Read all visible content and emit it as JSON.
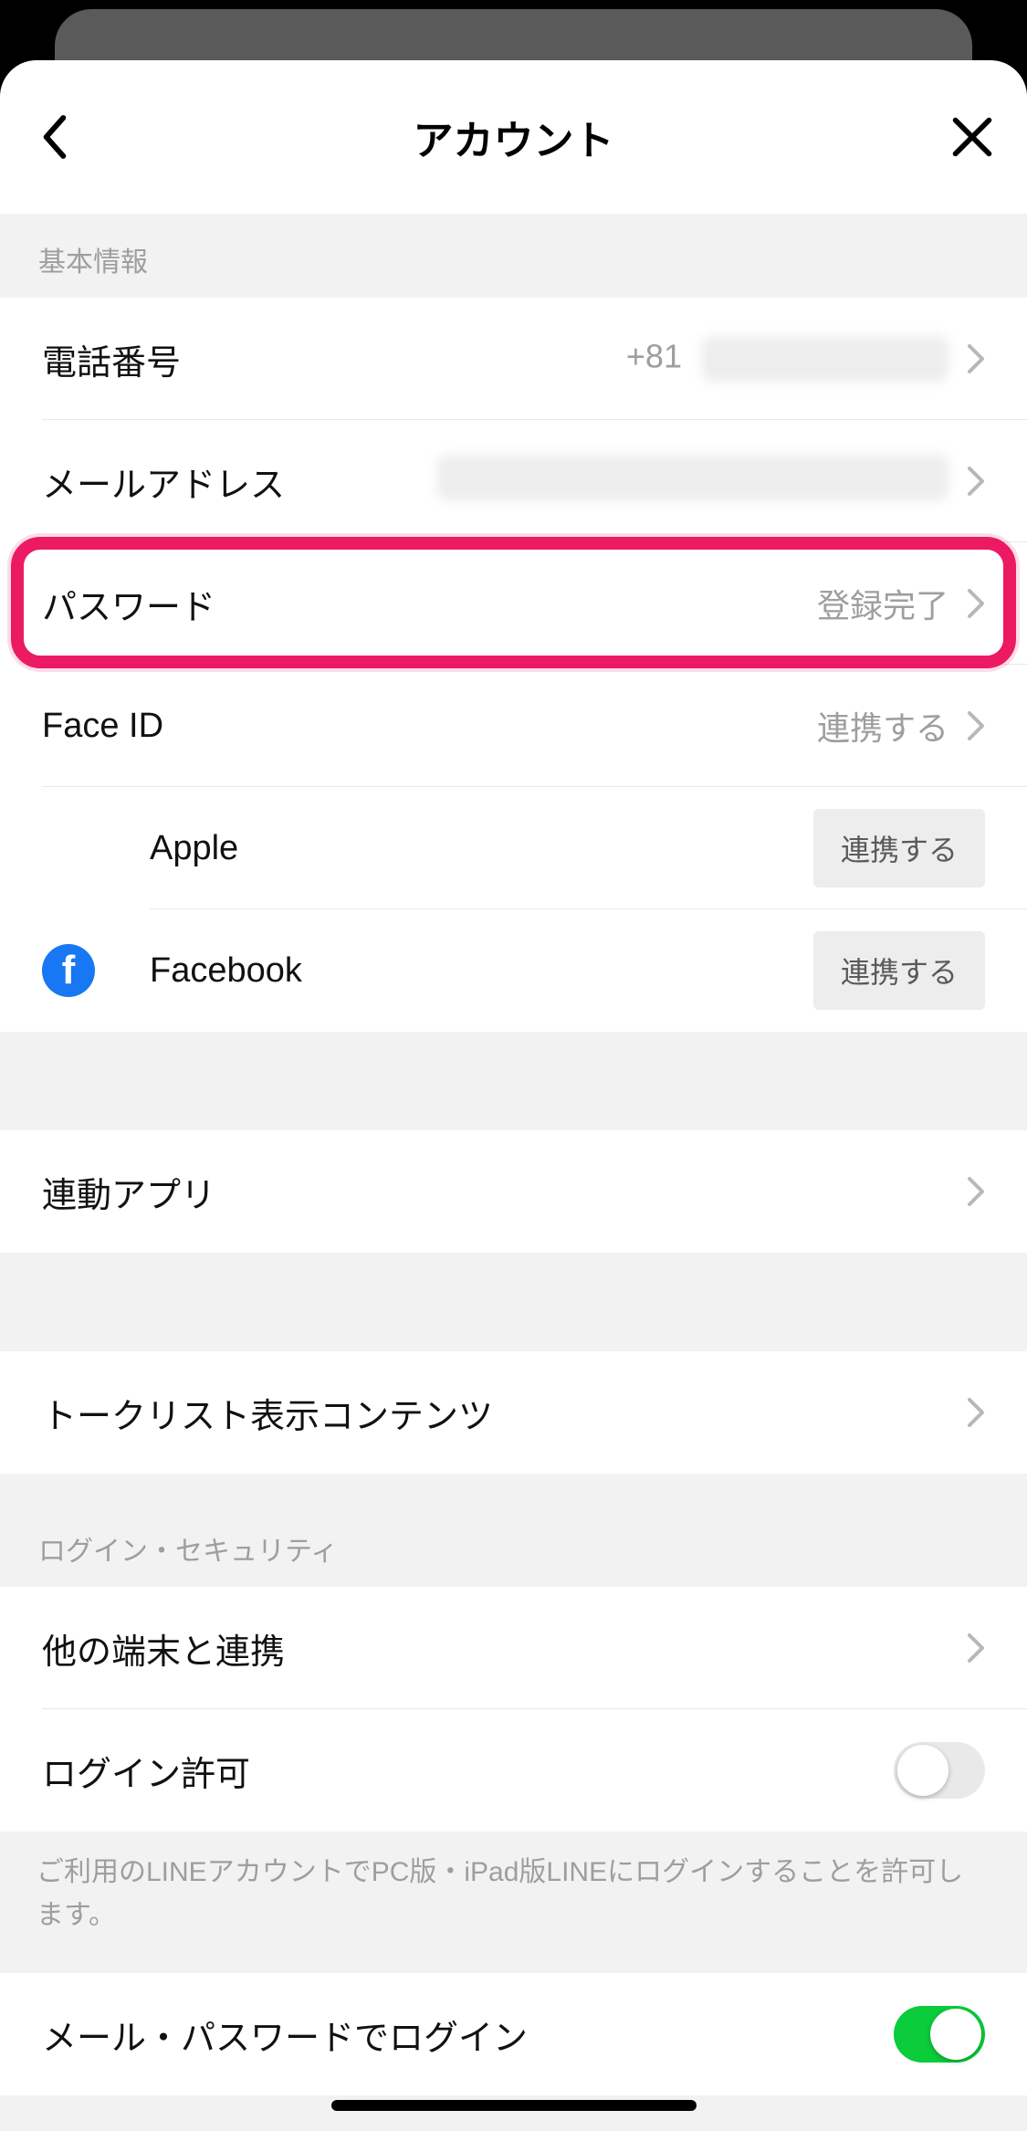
{
  "header": {
    "title": "アカウント"
  },
  "sections": {
    "basic": {
      "title": "基本情報"
    },
    "security": {
      "title": "ログイン・セキュリティ"
    }
  },
  "rows": {
    "phone": {
      "label": "電話番号",
      "prefix": "+81"
    },
    "email": {
      "label": "メールアドレス"
    },
    "password": {
      "label": "パスワード",
      "value": "登録完了"
    },
    "faceid": {
      "label": "Face ID",
      "value": "連携する"
    },
    "linkedApps": {
      "label": "連動アプリ"
    },
    "talkList": {
      "label": "トークリスト表示コンテンツ"
    },
    "otherDevice": {
      "label": "他の端末と連携"
    },
    "loginAllow": {
      "label": "ログイン許可"
    },
    "mailPwLogin": {
      "label": "メール・パスワードでログイン"
    }
  },
  "providers": {
    "apple": {
      "label": "Apple",
      "button": "連携する"
    },
    "facebook": {
      "label": "Facebook",
      "button": "連携する"
    }
  },
  "descriptions": {
    "loginAllow": "ご利用のLINEアカウントでPC版・iPad版LINEにログインすることを許可します。"
  },
  "toggles": {
    "loginAllow": false,
    "mailPwLogin": true
  }
}
